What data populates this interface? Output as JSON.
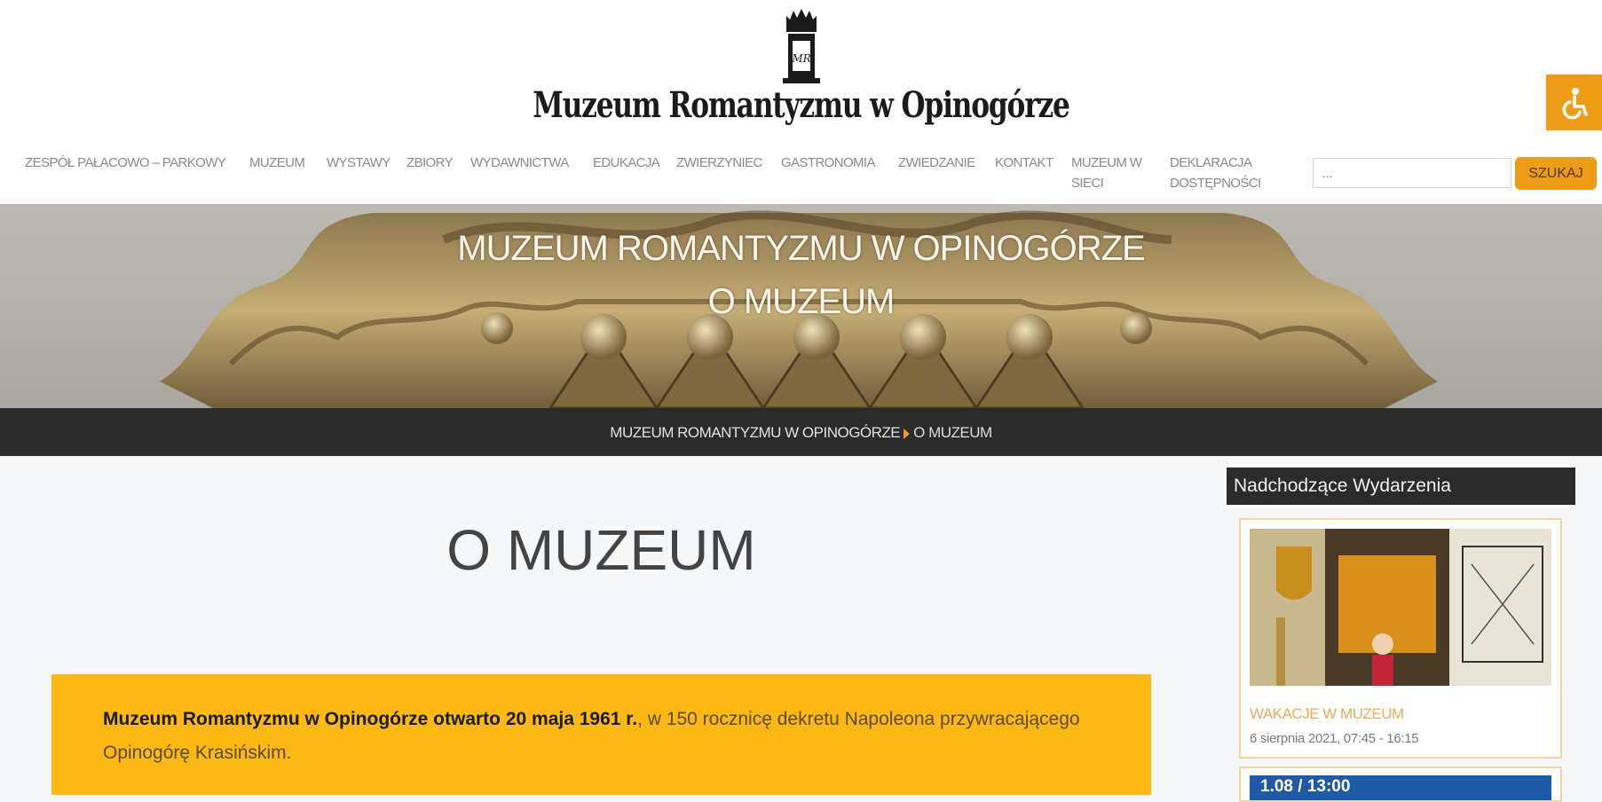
{
  "header": {
    "site_title": "Muzeum Romantyzmu w Opinogórze",
    "logo_monogram": "MR",
    "accessibility_icon": "wheelchair-icon"
  },
  "nav": {
    "items": [
      {
        "label": "Zespół pałacowo – parkowy"
      },
      {
        "label": "Muzeum"
      },
      {
        "label": "Wystawy"
      },
      {
        "label": "Zbiory"
      },
      {
        "label": "Wydawnictwa"
      },
      {
        "label": "Edukacja"
      },
      {
        "label": "Zwierzyniec"
      },
      {
        "label": "Gastronomia"
      },
      {
        "label": "Zwiedzanie"
      },
      {
        "label": "Kontakt"
      },
      {
        "label": "Muzeum w sieci"
      },
      {
        "label": "Deklaracja dostępności"
      }
    ]
  },
  "search": {
    "placeholder": "...",
    "button_label": "SZUKAJ"
  },
  "hero": {
    "title_line1": "MUZEUM ROMANTYZMU W OPINOGÓRZE",
    "title_line2": "O MUZEUM"
  },
  "breadcrumb": {
    "home": "MUZEUM ROMANTYZMU W OPINOGÓRZE",
    "current": "O MUZEUM"
  },
  "main": {
    "page_title": "O MUZEUM",
    "intro_bold": "Muzeum Romantyzmu w Opinogórze otwarto 20 maja 1961 r.",
    "intro_rest": ", w 150 rocznicę dekretu Napoleona przywracającego Opinogórę Krasińskim."
  },
  "sidebar": {
    "heading": "Nadchodzące Wydarzenia",
    "events": [
      {
        "title": "WAKACJE W MUZEUM",
        "date": "6 sierpnia 2021, 07:45 - 16:15"
      },
      {
        "title": "1.08 / 13:00"
      }
    ]
  },
  "colors": {
    "accent": "#ee9b16",
    "intro_bg": "#fcb813",
    "dark_bar": "#2b2b2b"
  }
}
